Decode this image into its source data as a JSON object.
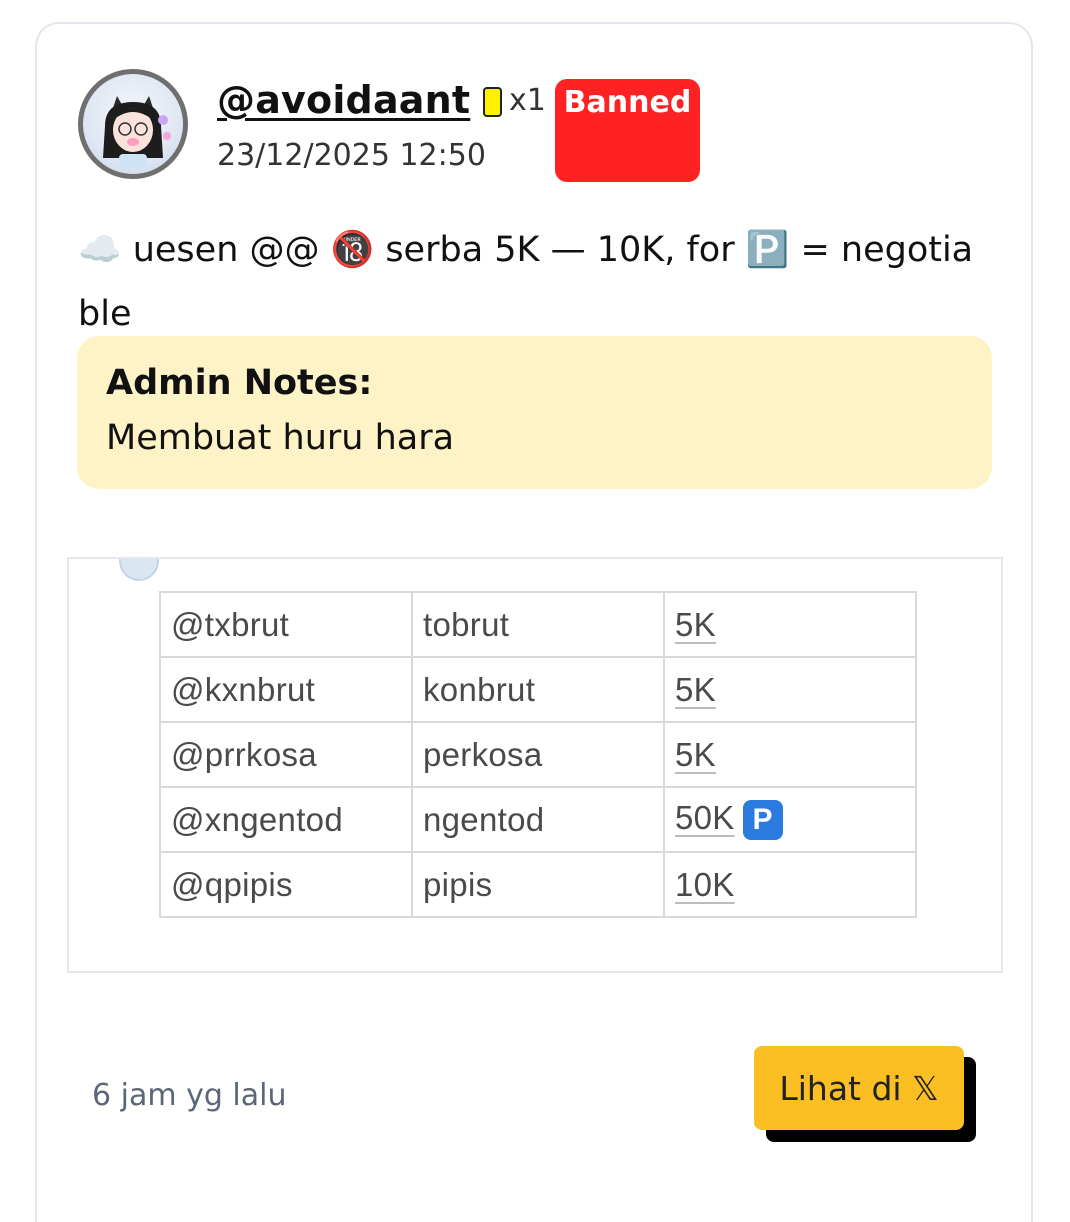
{
  "post": {
    "username": "@avoidaant",
    "warning_count": "x1",
    "status_badge": "Banned",
    "timestamp": "23/12/2025 12:50",
    "text": "☁️ uesen @@ 🔞 serba 5K — 10K, for 🅿️ = negotiable"
  },
  "admin_notes": {
    "title": "Admin Notes:",
    "body": "Membuat huru hara"
  },
  "embedded_table": {
    "rows": [
      {
        "handle": "@txbrut",
        "word": "tobrut",
        "price": "5K"
      },
      {
        "handle": "@kxnbrut",
        "word": "konbrut",
        "price": "5K"
      },
      {
        "handle": "@prrkosa",
        "word": "perkosa",
        "price": "5K"
      },
      {
        "handle": "@xngentod",
        "word": "ngentod",
        "price": "50K"
      },
      {
        "handle": "@qpipis",
        "word": "pipis",
        "price": "10K"
      }
    ],
    "p_badge": "P"
  },
  "footer": {
    "relative_time": "6 jam yg lalu",
    "view_button": "Lihat di 𝕏"
  },
  "colors": {
    "banned_bg": "#ff2222",
    "notes_bg": "#fef3c7",
    "button_bg": "#fbbf24",
    "warning_card": "#fff200"
  }
}
